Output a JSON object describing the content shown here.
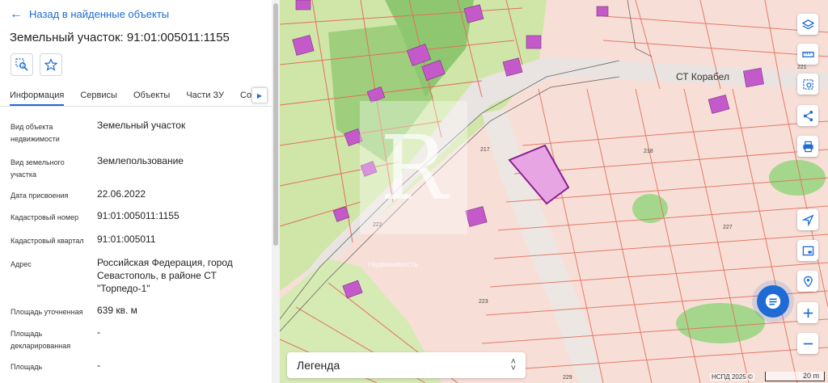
{
  "panel": {
    "back_label": "Назад в найденные объекты",
    "title": "Земельный участок: 91:01:005011:1155",
    "tabs": [
      "Информация",
      "Сервисы",
      "Объекты",
      "Части ЗУ",
      "Соста"
    ],
    "rows": [
      {
        "label": "Вид объекта недвижимости",
        "value": "Земельный участок"
      },
      {
        "label": "Вид земельного участка",
        "value": "Землепользование"
      },
      {
        "label": "Дата присвоения",
        "value": "22.06.2022"
      },
      {
        "label": "Кадастровый номер",
        "value": "91:01:005011:1155"
      },
      {
        "label": "Кадастровый квартал",
        "value": "91:01:005011"
      },
      {
        "label": "Адрес",
        "value": "Российская Федерация, город Севастополь, в районе СТ \"Торпедо-1\""
      },
      {
        "label": "Площадь уточненная",
        "value": "639 кв. м"
      },
      {
        "label": "Площадь декларированная",
        "value": "-"
      },
      {
        "label": "Площадь",
        "value": "-"
      }
    ]
  },
  "map": {
    "area_label": "СТ Корабел",
    "parcel_labels": [
      "218",
      "217",
      "227",
      "222",
      "223",
      "221",
      "229"
    ],
    "legend_label": "Легенда",
    "copyright": "НСПД 2025 ©",
    "scale_label": "20 m",
    "watermark_sub": "Недвижимость"
  },
  "controls": {
    "icons": [
      "layers-icon",
      "ruler-icon",
      "select-area-icon",
      "share-icon",
      "print-icon",
      "locate-icon",
      "minimap-icon",
      "marker-icon",
      "zoom-in-icon",
      "zoom-out-icon"
    ]
  },
  "colors": {
    "accent": "#1e6bd6",
    "parcel_line": "#e36f5b",
    "green_zone": "#a9d48a",
    "building": "#c45ac9"
  }
}
